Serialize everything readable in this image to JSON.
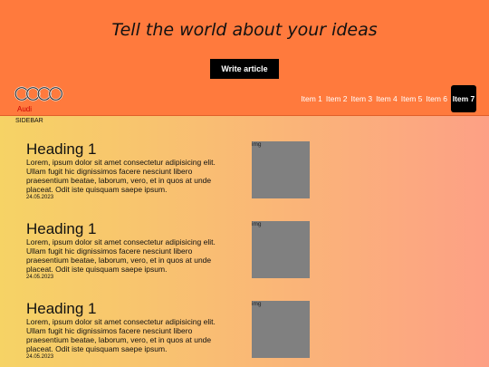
{
  "hero": {
    "title": "Tell the world about your ideas",
    "button_label": "Write article"
  },
  "navbar": {
    "logo_text": "Audi",
    "items": [
      {
        "label": "Item 1"
      },
      {
        "label": "Item 2"
      },
      {
        "label": "Item 3"
      },
      {
        "label": "Item 4"
      },
      {
        "label": "Item 5"
      },
      {
        "label": "Item 6"
      },
      {
        "label": "Item 7",
        "active": true
      }
    ]
  },
  "sidebar": {
    "label": "SIDEBAR"
  },
  "articles": [
    {
      "heading": "Heading 1",
      "body": "Lorem, ipsum dolor sit amet consectetur adipisicing elit. Ullam fugit hic dignissimos facere nesciunt libero praesentium beatae, laborum, vero, et in quos at unde placeat. Odit iste quisquam saepe ipsum.",
      "date": "24.05.2023",
      "img_alt": "img"
    },
    {
      "heading": "Heading 1",
      "body": "Lorem, ipsum dolor sit amet consectetur adipisicing elit. Ullam fugit hic dignissimos facere nesciunt libero praesentium beatae, laborum, vero, et in quos at unde placeat. Odit iste quisquam saepe ipsum.",
      "date": "24.05.2023",
      "img_alt": "img"
    },
    {
      "heading": "Heading 1",
      "body": "Lorem, ipsum dolor sit amet consectetur adipisicing elit. Ullam fugit hic dignissimos facere nesciunt libero praesentium beatae, laborum, vero, et in quos at unde placeat. Odit iste quisquam saepe ipsum.",
      "date": "24.05.2023",
      "img_alt": "img"
    }
  ],
  "colors": {
    "header": "#ff7a3d",
    "gradient_start": "#f6d365",
    "gradient_end": "#fda085",
    "button": "#000000",
    "thumb": "#808080"
  }
}
